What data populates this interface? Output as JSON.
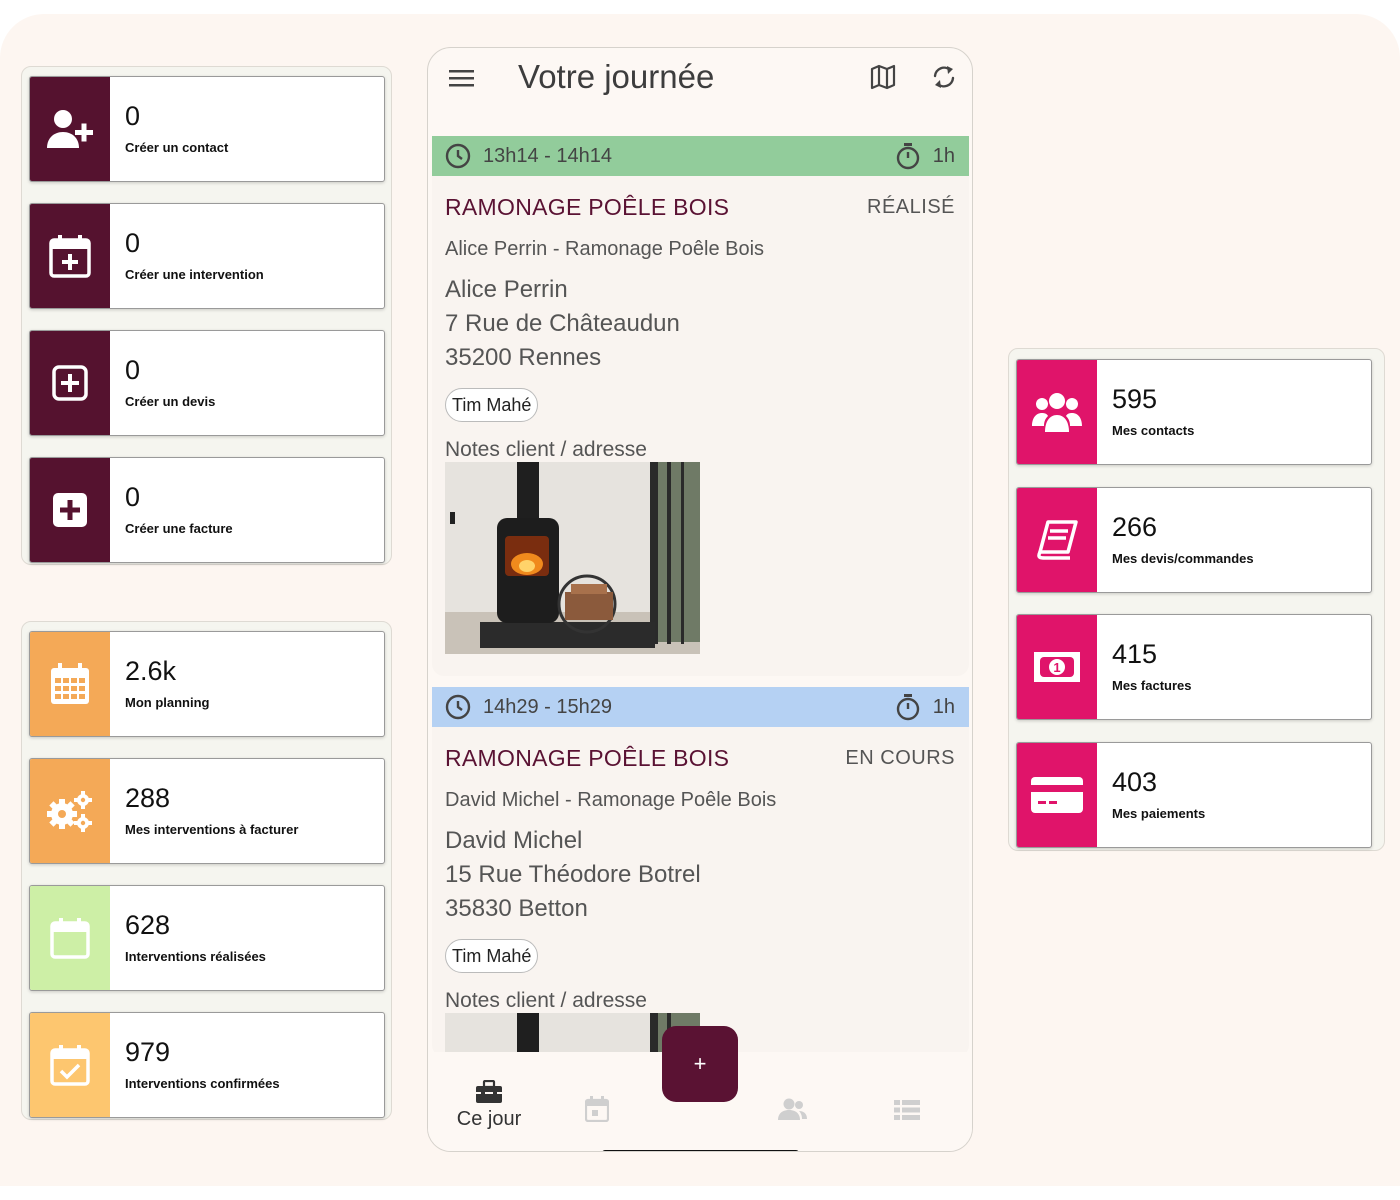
{
  "app": {
    "title": "Votre journée"
  },
  "icons": {
    "menu": "menu-icon",
    "map": "map-icon",
    "sync": "sync-icon",
    "clock": "clock-icon",
    "stopwatch": "stopwatch-icon"
  },
  "create_panel": {
    "items": [
      {
        "value": "0",
        "label": "Créer un contact",
        "icon": "user-plus-icon"
      },
      {
        "value": "0",
        "label": "Créer une intervention",
        "icon": "calendar-plus-icon"
      },
      {
        "value": "0",
        "label": "Créer un devis",
        "icon": "square-plus-outline-icon"
      },
      {
        "value": "0",
        "label": "Créer une facture",
        "icon": "square-plus-icon"
      }
    ],
    "color": "#55122f"
  },
  "planning_panel": {
    "items": [
      {
        "value": "2.6k",
        "label": "Mon planning",
        "icon": "calendar-grid-icon",
        "color": "#f4a957"
      },
      {
        "value": "288",
        "label": "Mes interventions à facturer",
        "icon": "gears-icon",
        "color": "#f4a957"
      },
      {
        "value": "628",
        "label": "Interventions réalisées",
        "icon": "calendar-empty-icon",
        "color": "#cdefa6"
      },
      {
        "value": "979",
        "label": "Interventions confirmées",
        "icon": "calendar-check-icon",
        "color": "#fdc66f"
      }
    ]
  },
  "records_panel": {
    "items": [
      {
        "value": "595",
        "label": "Mes contacts",
        "icon": "users-icon"
      },
      {
        "value": "266",
        "label": "Mes devis/commandes",
        "icon": "book-icon"
      },
      {
        "value": "415",
        "label": "Mes factures",
        "icon": "banknote-icon"
      },
      {
        "value": "403",
        "label": "Mes paiements",
        "icon": "credit-card-icon"
      }
    ],
    "color": "#e0146a"
  },
  "appointments": [
    {
      "time": "13h14 - 14h14",
      "duration": "1h",
      "bar_color": "#92cc9b",
      "service": "RAMONAGE POÊLE BOIS",
      "status": "RÉALISÉ",
      "subtitle": "Alice Perrin - Ramonage Poêle Bois",
      "name": "Alice Perrin",
      "street": "7 Rue de Châteaudun",
      "city": "35200 Rennes",
      "technician": "Tim Mahé",
      "notes_label": "Notes client / adresse"
    },
    {
      "time": "14h29 - 15h29",
      "duration": "1h",
      "bar_color": "#b5d1f3",
      "service": "RAMONAGE POÊLE BOIS",
      "status": "EN COURS",
      "subtitle": "David Michel - Ramonage Poêle Bois",
      "name": "David Michel",
      "street": "15 Rue Théodore Botrel",
      "city": "35830 Betton",
      "technician": "Tim Mahé",
      "notes_label": "Notes client / adresse"
    }
  ],
  "nav": {
    "items": [
      {
        "label": "Ce jour",
        "icon": "toolbox-icon",
        "active": true
      },
      {
        "label": "",
        "icon": "calendar-icon",
        "active": false
      },
      {
        "label": "",
        "icon": "contacts-icon",
        "active": false
      },
      {
        "label": "",
        "icon": "list-icon",
        "active": false
      }
    ],
    "fab_label": "+"
  }
}
